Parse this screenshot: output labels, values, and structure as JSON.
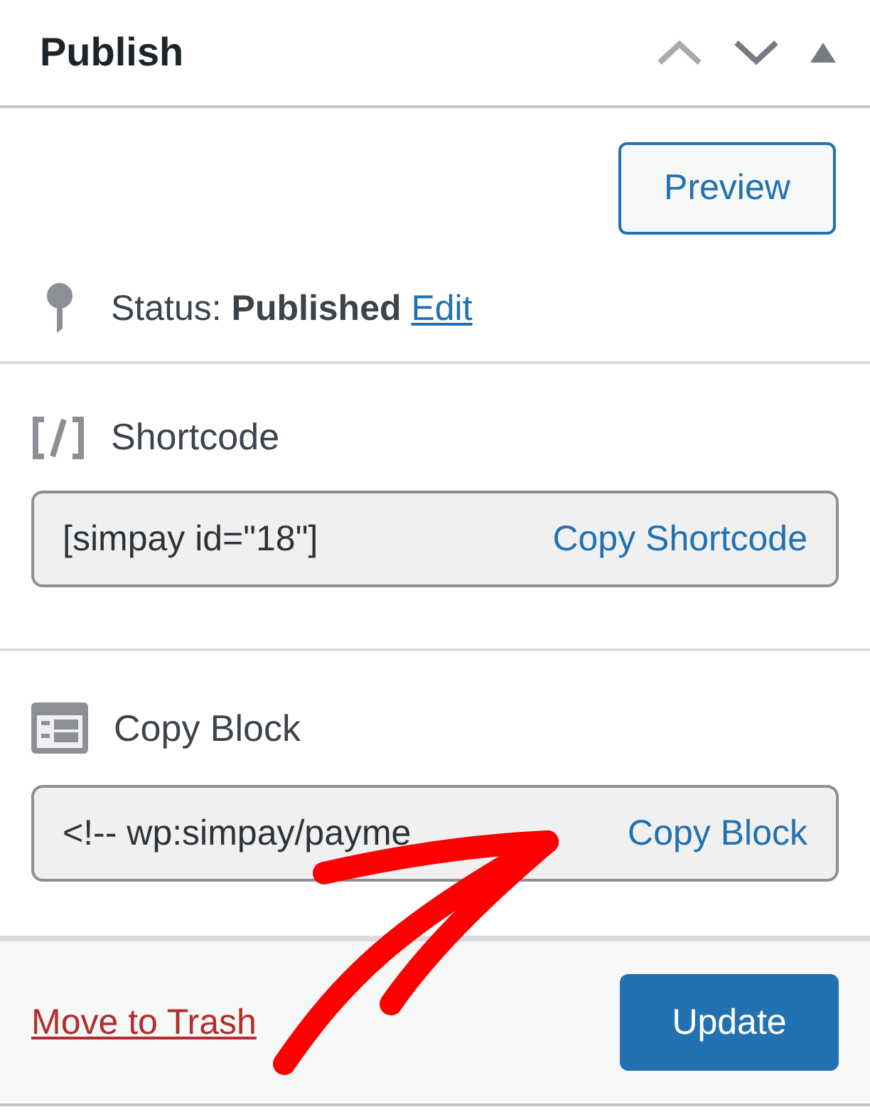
{
  "panel": {
    "title": "Publish"
  },
  "preview_button": "Preview",
  "status": {
    "label": "Status:",
    "value": "Published",
    "link": "Edit"
  },
  "sections": [
    {
      "kind": "shortcode",
      "title": "Shortcode",
      "value": "[simpay id=\"18\"]",
      "action": "Copy Shortcode"
    },
    {
      "kind": "block",
      "title": "Copy Block",
      "value": "<!-- wp:simpay/payme",
      "action": "Copy Block"
    }
  ],
  "footer": {
    "trash_link": "Move to Trash",
    "update_button": "Update"
  }
}
